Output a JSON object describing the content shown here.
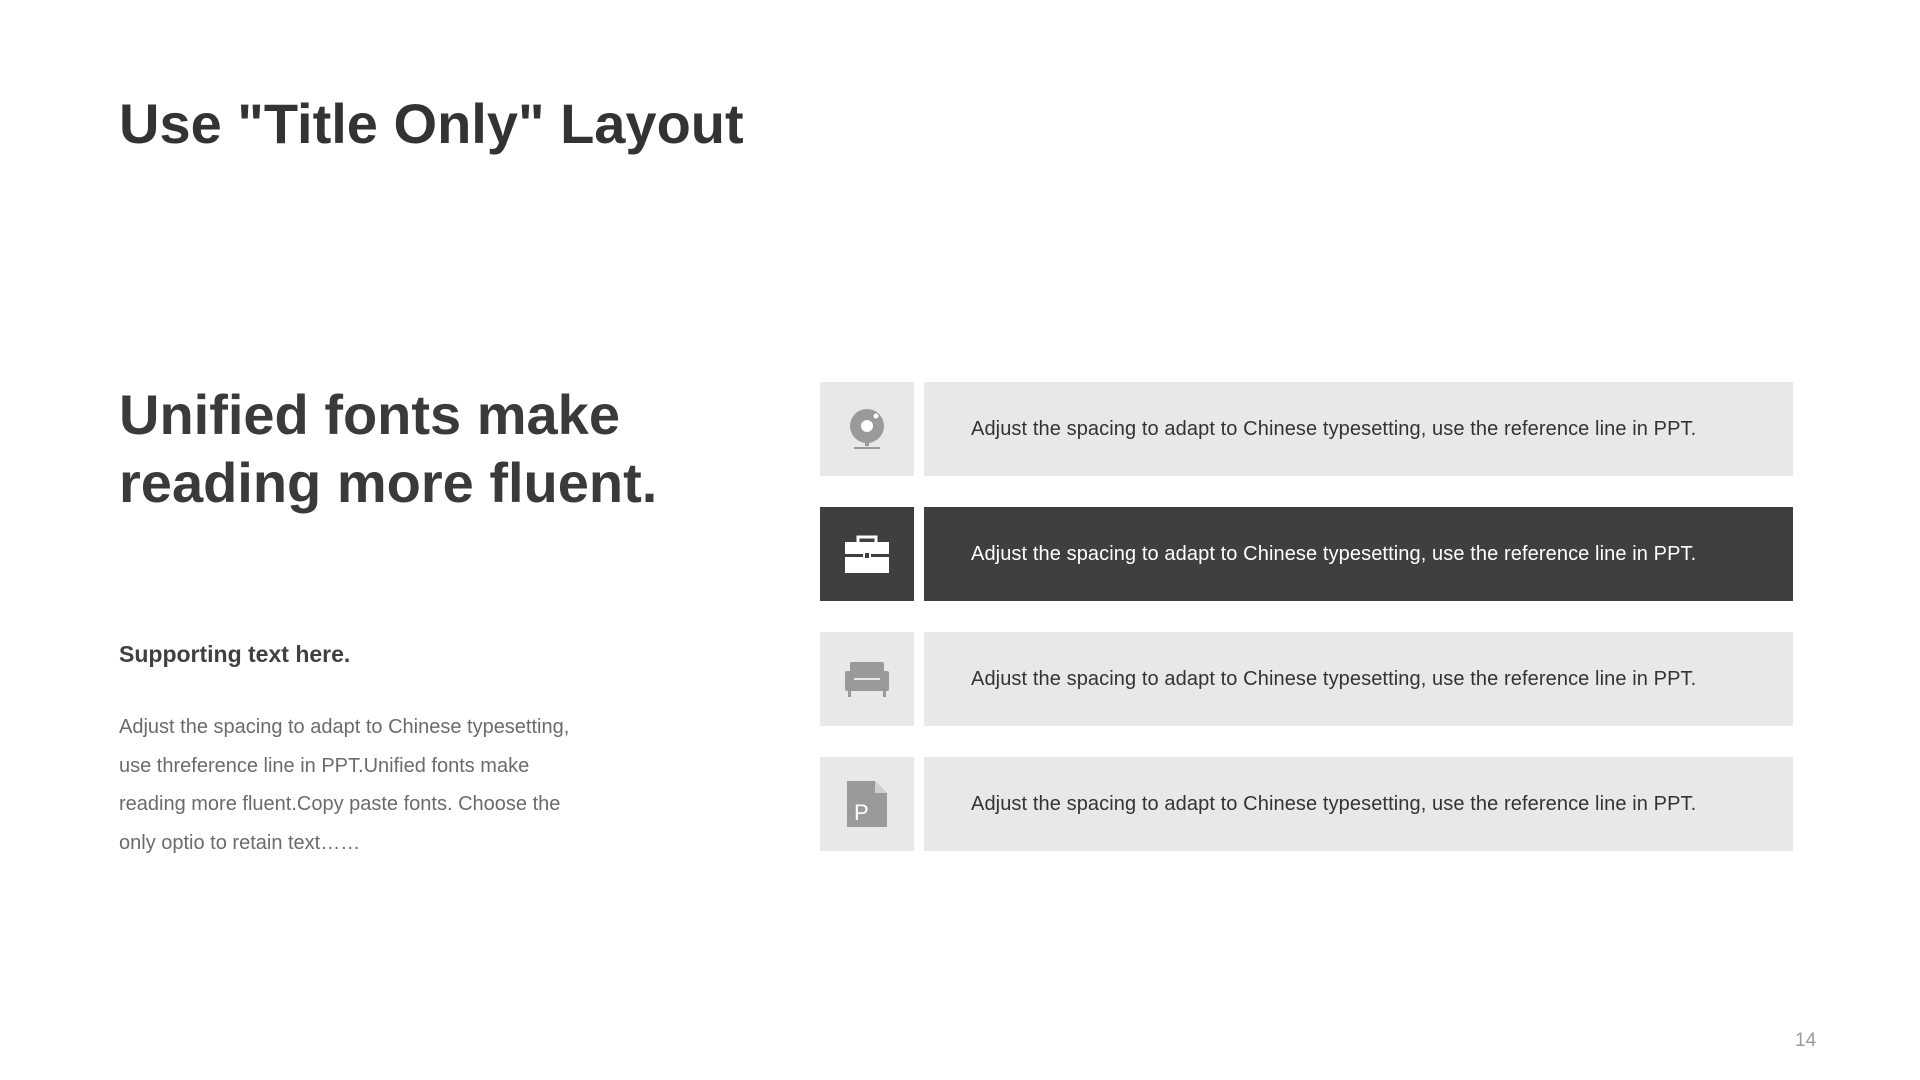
{
  "slide": {
    "title": "Use \"Title Only\" Layout",
    "headline": [
      "Unified fonts make",
      "reading more fluent."
    ],
    "support_title": "Supporting text here.",
    "support_body_lines": [
      "Adjust the spacing to adapt to Chinese typesetting,",
      "use threference line in PPT.Unified fonts make",
      "reading more fluent.Copy paste fonts. Choose the",
      "only optio to retain text……"
    ],
    "page_number": "14"
  },
  "items": [
    {
      "icon": "webcam-icon",
      "text": "Adjust the spacing to adapt to Chinese typesetting, use the reference line in PPT.",
      "active": false
    },
    {
      "icon": "briefcase-icon",
      "text": "Adjust the spacing to adapt to Chinese typesetting, use the reference line in PPT.",
      "active": true
    },
    {
      "icon": "armchair-icon",
      "text": "Adjust the spacing to adapt to Chinese typesetting, use the reference line in PPT.",
      "active": false
    },
    {
      "icon": "document-p-icon",
      "text": "Adjust the spacing to adapt to Chinese typesetting, use the reference line in PPT.",
      "active": false
    }
  ],
  "colors": {
    "background": "#ffffff",
    "title": "#333333",
    "light_fill": "#e8e8e8",
    "dark_fill": "#3f3f3f",
    "icon_grey": "#999999",
    "body_text": "#6b6b6b"
  }
}
